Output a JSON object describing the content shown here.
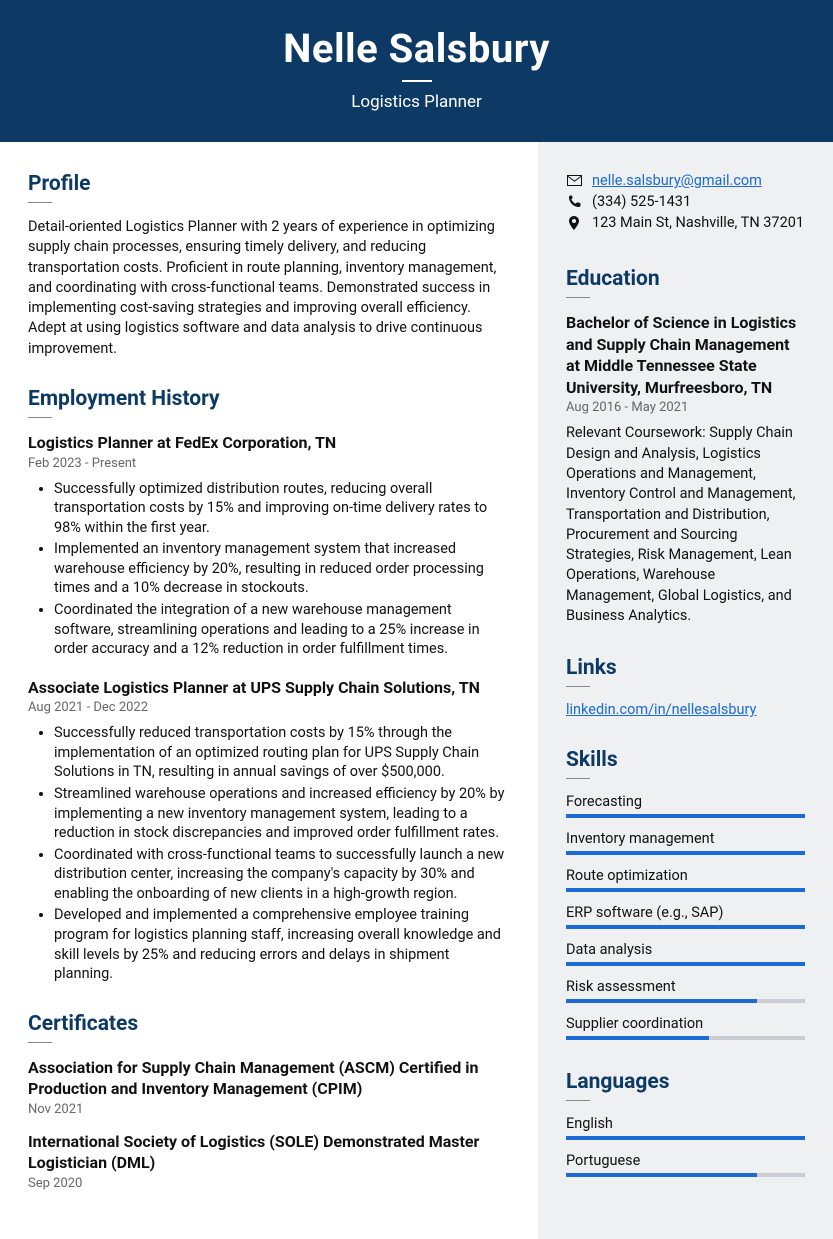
{
  "header": {
    "name": "Nelle Salsbury",
    "role": "Logistics Planner"
  },
  "profile": {
    "heading": "Profile",
    "text": "Detail-oriented Logistics Planner with 2 years of experience in optimizing supply chain processes, ensuring timely delivery, and reducing transportation costs. Proficient in route planning, inventory management, and coordinating with cross-functional teams. Demonstrated success in implementing cost-saving strategies and improving overall efficiency. Adept at using logistics software and data analysis to drive continuous improvement."
  },
  "employment": {
    "heading": "Employment History",
    "jobs": [
      {
        "title": "Logistics Planner at FedEx Corporation, TN",
        "date": "Feb 2023 - Present",
        "bullets": [
          "Successfully optimized distribution routes, reducing overall transportation costs by 15% and improving on-time delivery rates to 98% within the first year.",
          "Implemented an inventory management system that increased warehouse efficiency by 20%, resulting in reduced order processing times and a 10% decrease in stockouts.",
          "Coordinated the integration of a new warehouse management software, streamlining operations and leading to a 25% increase in order accuracy and a 12% reduction in order fulfillment times."
        ]
      },
      {
        "title": "Associate Logistics Planner at UPS Supply Chain Solutions, TN",
        "date": "Aug 2021 - Dec 2022",
        "bullets": [
          "Successfully reduced transportation costs by 15% through the implementation of an optimized routing plan for UPS Supply Chain Solutions in TN, resulting in annual savings of over $500,000.",
          "Streamlined warehouse operations and increased efficiency by 20% by implementing a new inventory management system, leading to a reduction in stock discrepancies and improved order fulfillment rates.",
          "Coordinated with cross-functional teams to successfully launch a new distribution center, increasing the company's capacity by 30% and enabling the onboarding of new clients in a high-growth region.",
          "Developed and implemented a comprehensive employee training program for logistics planning staff, increasing overall knowledge and skill levels by 25% and reducing errors and delays in shipment planning."
        ]
      }
    ]
  },
  "certificates": {
    "heading": "Certificates",
    "items": [
      {
        "title": "Association for Supply Chain Management (ASCM) Certified in Production and Inventory Management (CPIM)",
        "date": "Nov 2021"
      },
      {
        "title": "International Society of Logistics (SOLE) Demonstrated Master Logistician (DML)",
        "date": "Sep 2020"
      }
    ]
  },
  "contact": {
    "email": "nelle.salsbury@gmail.com",
    "phone": "(334) 525-1431",
    "address": "123 Main St, Nashville, TN 37201"
  },
  "education": {
    "heading": "Education",
    "title": "Bachelor of Science in Logistics and Supply Chain Management at Middle Tennessee State University, Murfreesboro, TN",
    "date": "Aug 2016 - May 2021",
    "desc": "Relevant Coursework: Supply Chain Design and Analysis, Logistics Operations and Management, Inventory Control and Management, Transportation and Distribution, Procurement and Sourcing Strategies, Risk Management, Lean Operations, Warehouse Management, Global Logistics, and Business Analytics."
  },
  "links": {
    "heading": "Links",
    "items": [
      {
        "text": "linkedin.com/in/nellesalsbury"
      }
    ]
  },
  "skills": {
    "heading": "Skills",
    "items": [
      {
        "name": "Forecasting",
        "level": 100
      },
      {
        "name": "Inventory management",
        "level": 100
      },
      {
        "name": "Route optimization",
        "level": 100
      },
      {
        "name": "ERP software (e.g., SAP)",
        "level": 100
      },
      {
        "name": "Data analysis",
        "level": 100
      },
      {
        "name": "Risk assessment",
        "level": 80
      },
      {
        "name": "Supplier coordination",
        "level": 60
      }
    ]
  },
  "languages": {
    "heading": "Languages",
    "items": [
      {
        "name": "English",
        "level": 100
      },
      {
        "name": "Portuguese",
        "level": 80
      }
    ]
  }
}
